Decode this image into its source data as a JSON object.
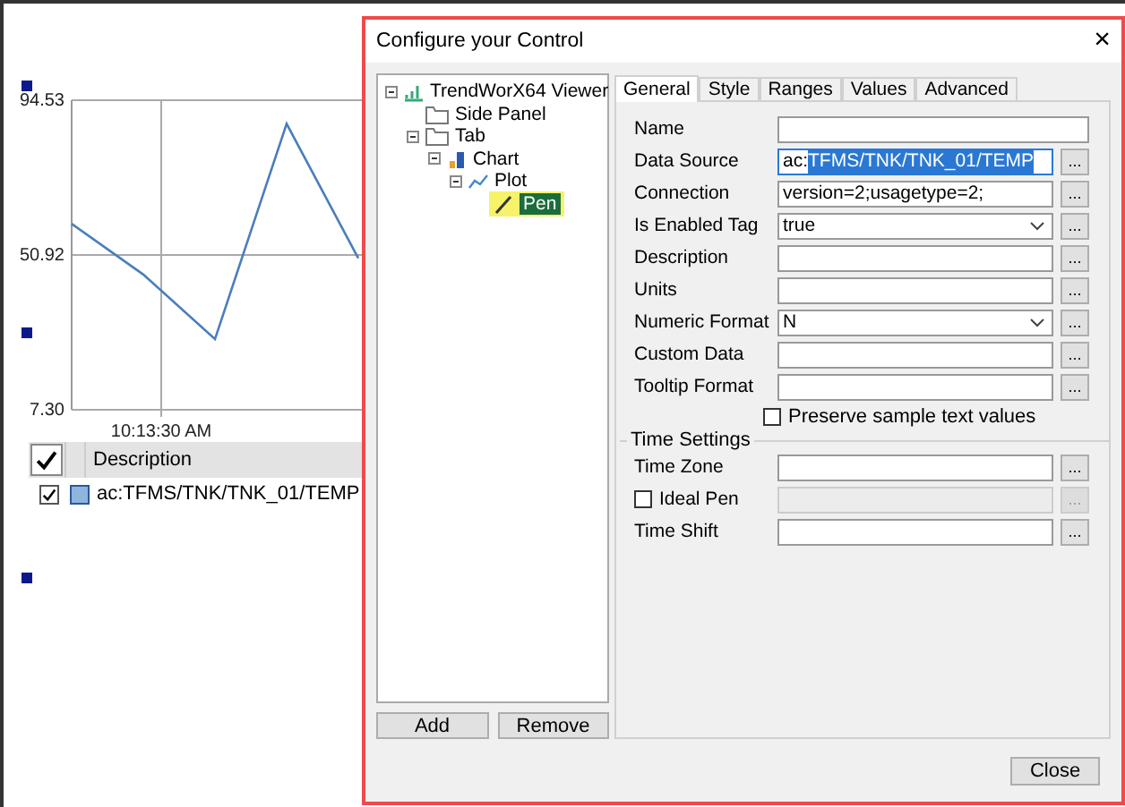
{
  "chart": {
    "x_tick_label": "10:13:30 AM",
    "chart_data": {
      "type": "line",
      "ylim": [
        7.3,
        94.53
      ],
      "yticks": [
        {
          "value": 94.53,
          "label": "94.53"
        },
        {
          "value": 50.92,
          "label": "50.92"
        },
        {
          "value": 7.3,
          "label": "7.30"
        }
      ],
      "series": [
        {
          "color": "#4a7ebb",
          "values": [
            59.7,
            45.4,
            27.2,
            87.9,
            50.0
          ]
        }
      ]
    }
  },
  "legend": {
    "header_checked": true,
    "columns": [
      "Description"
    ],
    "rows": [
      {
        "checked": true,
        "description": "ac:TFMS/TNK/TNK_01/TEMP"
      }
    ]
  },
  "dialog": {
    "title": "Configure your Control",
    "close": "×",
    "tree": [
      {
        "label": "TrendWorX64 Viewer",
        "kind": "viewer",
        "expanded": true,
        "selected": false,
        "children": [
          {
            "label": "Side Panel",
            "kind": "folder",
            "selected": false
          },
          {
            "label": "Tab",
            "kind": "folder",
            "expanded": true,
            "selected": false,
            "children": [
              {
                "label": "Chart",
                "kind": "chart",
                "expanded": true,
                "selected": false,
                "children": [
                  {
                    "label": "Plot",
                    "kind": "plot",
                    "expanded": true,
                    "selected": false,
                    "children": [
                      {
                        "label": "Pen",
                        "kind": "pen",
                        "selected": true
                      }
                    ]
                  }
                ]
              }
            ]
          }
        ]
      }
    ],
    "tree_buttons": [
      "Add",
      "Remove"
    ],
    "tabs": [
      {
        "label": "General",
        "selected": true
      },
      {
        "label": "Style",
        "selected": false
      },
      {
        "label": "Ranges",
        "selected": false
      },
      {
        "label": "Values",
        "selected": false
      },
      {
        "label": "Advanced",
        "selected": false
      }
    ],
    "fields": [
      {
        "kind": "wide_text",
        "label": "Name"
      },
      {
        "kind": "focused_text",
        "label": "Data Source",
        "value_parts": [
          {
            "text": "ac:",
            "selected": false
          },
          {
            "text": "TFMS/TNK/TNK_01/TEMP",
            "selected": true
          }
        ],
        "button": "..."
      },
      {
        "kind": "text",
        "label": "Connection",
        "value_parts": [
          {
            "text": "version=2;usagetype=2;",
            "selected": false
          }
        ],
        "button": "..."
      },
      {
        "kind": "combo",
        "label": "Is Enabled Tag",
        "value_parts": [
          {
            "text": "true",
            "selected": false
          }
        ],
        "button": "..."
      },
      {
        "kind": "text",
        "label": "Description",
        "button": "..."
      },
      {
        "kind": "text",
        "label": "Units",
        "button": "..."
      },
      {
        "kind": "combo",
        "label": "Numeric Format",
        "value_parts": [
          {
            "text": "N",
            "selected": false
          }
        ],
        "button": "..."
      },
      {
        "kind": "text",
        "label": "Custom Data",
        "button": "..."
      },
      {
        "kind": "text",
        "label": "Tooltip Format",
        "button": "..."
      },
      {
        "kind": "check",
        "label": "Preserve sample text values",
        "checked": false
      }
    ],
    "time_settings": {
      "title": "Time Settings",
      "fields": [
        {
          "kind": "field",
          "label": "Time Zone",
          "disabled": false,
          "button": "..."
        },
        {
          "kind": "checkbox_field",
          "label": "Ideal Pen",
          "checked": false,
          "disabled": true,
          "button": "..."
        },
        {
          "kind": "field",
          "label": "Time Shift",
          "disabled": false,
          "button": "..."
        }
      ]
    },
    "close_button": "Close"
  }
}
